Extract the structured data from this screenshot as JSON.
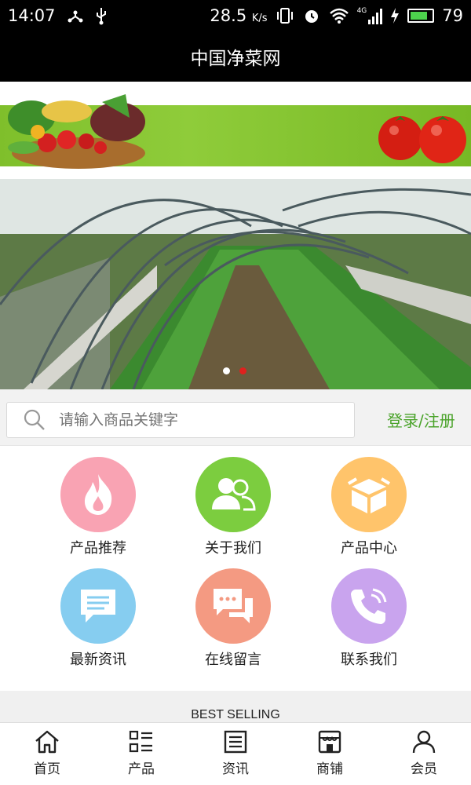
{
  "status": {
    "time": "14:07",
    "speed": "28.5",
    "speed_unit": "K/s",
    "signal_label": "4G",
    "battery": "79"
  },
  "header": {
    "title": "中国净菜网"
  },
  "carousel": {
    "active_index": 1,
    "count": 2
  },
  "search": {
    "placeholder": "请输入商品关键字",
    "login_label": "登录/注册"
  },
  "menu": {
    "items": [
      {
        "label": "产品推荐",
        "icon": "fire-icon",
        "color": "#f9a3b3"
      },
      {
        "label": "关于我们",
        "icon": "users-icon",
        "color": "#7ccd3f"
      },
      {
        "label": "产品中心",
        "icon": "box-icon",
        "color": "#ffc46b"
      },
      {
        "label": "最新资讯",
        "icon": "message-icon",
        "color": "#86cdf0"
      },
      {
        "label": "在线留言",
        "icon": "chat-icon",
        "color": "#f49a82"
      },
      {
        "label": "联系我们",
        "icon": "phone-icon",
        "color": "#c9a4ee"
      }
    ]
  },
  "section": {
    "best_selling": "BEST SELLING"
  },
  "tabs": [
    {
      "label": "首页",
      "icon": "home-icon"
    },
    {
      "label": "产品",
      "icon": "list-icon"
    },
    {
      "label": "资讯",
      "icon": "news-icon"
    },
    {
      "label": "商铺",
      "icon": "shop-icon"
    },
    {
      "label": "会员",
      "icon": "user-icon"
    }
  ],
  "colors": {
    "accent": "#4aa32a",
    "active_dot": "#e0211e"
  }
}
